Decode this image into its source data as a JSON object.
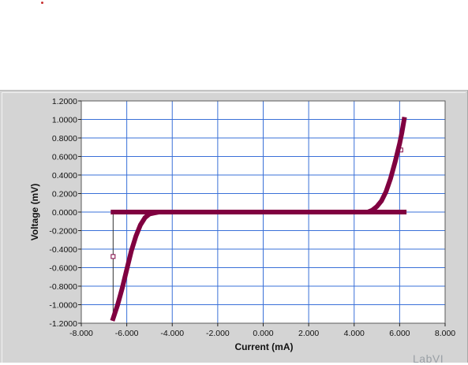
{
  "window": {
    "marker_color": "#c83232"
  },
  "graph": {
    "background": "#d4d4d4",
    "plot_background": "#ffffff",
    "grid_color": "#3a70d8",
    "trace_color": "#800040",
    "watermark": "LabVI"
  },
  "chart_data": {
    "type": "line",
    "title": "",
    "xlabel": "Current (mA)",
    "ylabel": "Voltage (mV)",
    "xlim": [
      -8,
      8
    ],
    "ylim": [
      -1.2,
      1.2
    ],
    "grid": true,
    "x_ticks": [
      -8,
      -6,
      -4,
      -2,
      0,
      2,
      4,
      6,
      8
    ],
    "y_ticks": [
      1.2,
      1.0,
      0.8,
      0.6,
      0.4,
      0.2,
      0.0,
      -0.2,
      -0.4,
      -0.6,
      -0.8,
      -1.0,
      -1.2
    ],
    "x_tick_labels": [
      "-8.000",
      "-6.000",
      "-4.000",
      "-2.000",
      "0.000",
      "2.000",
      "4.000",
      "6.000",
      "8.000"
    ],
    "y_tick_labels": [
      "1.2000",
      "1.0000",
      "0.8000",
      "0.6000",
      "0.4000",
      "0.2000",
      "0.0000",
      "-0.2000",
      "-0.4000",
      "-0.6000",
      "-0.8000",
      "-1.0000",
      "-1.2000"
    ],
    "series": [
      {
        "x": [
          -6.6,
          -6.4,
          -6.2,
          -6.0,
          -5.8,
          -5.6,
          -5.4,
          -5.2,
          -5.0,
          -4.8,
          -4.6,
          -3.6,
          -2.0,
          0.0,
          2.0,
          4.0,
          4.6,
          4.8,
          5.0,
          5.2,
          5.4,
          5.6,
          5.8,
          6.0,
          6.1,
          6.2
        ],
        "y": [
          -1.15,
          -1.0,
          -0.82,
          -0.62,
          -0.42,
          -0.26,
          -0.14,
          -0.06,
          -0.02,
          -0.01,
          0.0,
          0.0,
          0.0,
          0.0,
          0.0,
          0.0,
          0.0,
          0.02,
          0.06,
          0.12,
          0.22,
          0.36,
          0.54,
          0.74,
          0.86,
          1.0
        ]
      },
      {
        "x": [
          -6.6,
          6.2
        ],
        "y": [
          0.0,
          0.0
        ]
      }
    ],
    "cursors": [
      {
        "x": -6.6,
        "y": -0.48,
        "bottom": -1.15
      },
      {
        "x": 6.05,
        "y": 0.67,
        "bottom": 0.0
      }
    ]
  }
}
